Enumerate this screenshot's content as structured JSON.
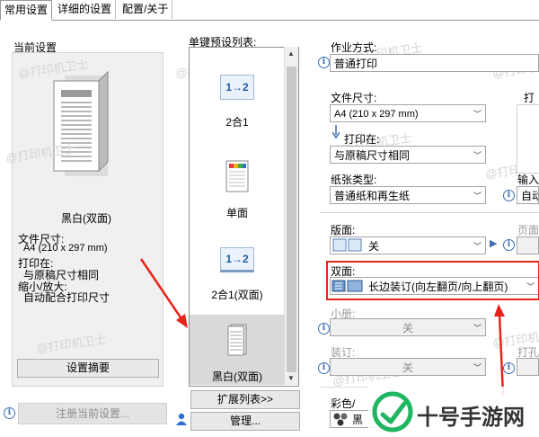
{
  "tabs": [
    "常用设置",
    "详细的设置",
    "配置/关于"
  ],
  "left": {
    "current_settings_label": "当前设置",
    "mode_label": "黑白(双面)",
    "paper_size_label": "文件尺寸:",
    "paper_size_value": "A4 (210 x 297 mm)",
    "print_on_label": "打印在:",
    "print_on_value": "与原稿尺寸相同",
    "zoom_label": "缩小/放大:",
    "zoom_value": "自动配合打印尺寸",
    "summary_button": "设置摘要",
    "register_button": "注册当前设置..."
  },
  "presets": {
    "label": "单键预设列表:",
    "items": [
      "2合1",
      "单面",
      "2合1(双面)",
      "黑白(双面)"
    ],
    "icon_text": "1→2",
    "expand_button": "扩展列表>>",
    "manage_button": "管理..."
  },
  "right": {
    "job_type_label": "作业方式:",
    "job_type_value": "普通打印",
    "paper_size_label": "文件尺寸:",
    "paper_size_value": "A4 (210 x 297 mm)",
    "print_on_label": "打印在:",
    "print_on_value": "与原稿尺寸相同",
    "paper_type_label": "纸张类型:",
    "paper_type_value": "普通纸和再生纸",
    "layout_label": "版面:",
    "layout_value": "关",
    "duplex_label": "双面:",
    "duplex_value": "长边装订(向左翻页/向上翻页)",
    "booklet_label": "小册:",
    "booklet_value": "关",
    "binding_label": "装订:",
    "binding_value": "关",
    "color_label": "彩色/",
    "color_value": "黑",
    "print_cut": "打",
    "input_cut": "输入",
    "auto_cut": "自动",
    "page_cut": "页面",
    "punch_cut": "打孔"
  },
  "watermark": "@打印机卫士",
  "brand": "十号手游网",
  "colors": {
    "annotation": "#e8231a",
    "brand_green": "#20b560",
    "info_blue": "#3c6eb4"
  }
}
